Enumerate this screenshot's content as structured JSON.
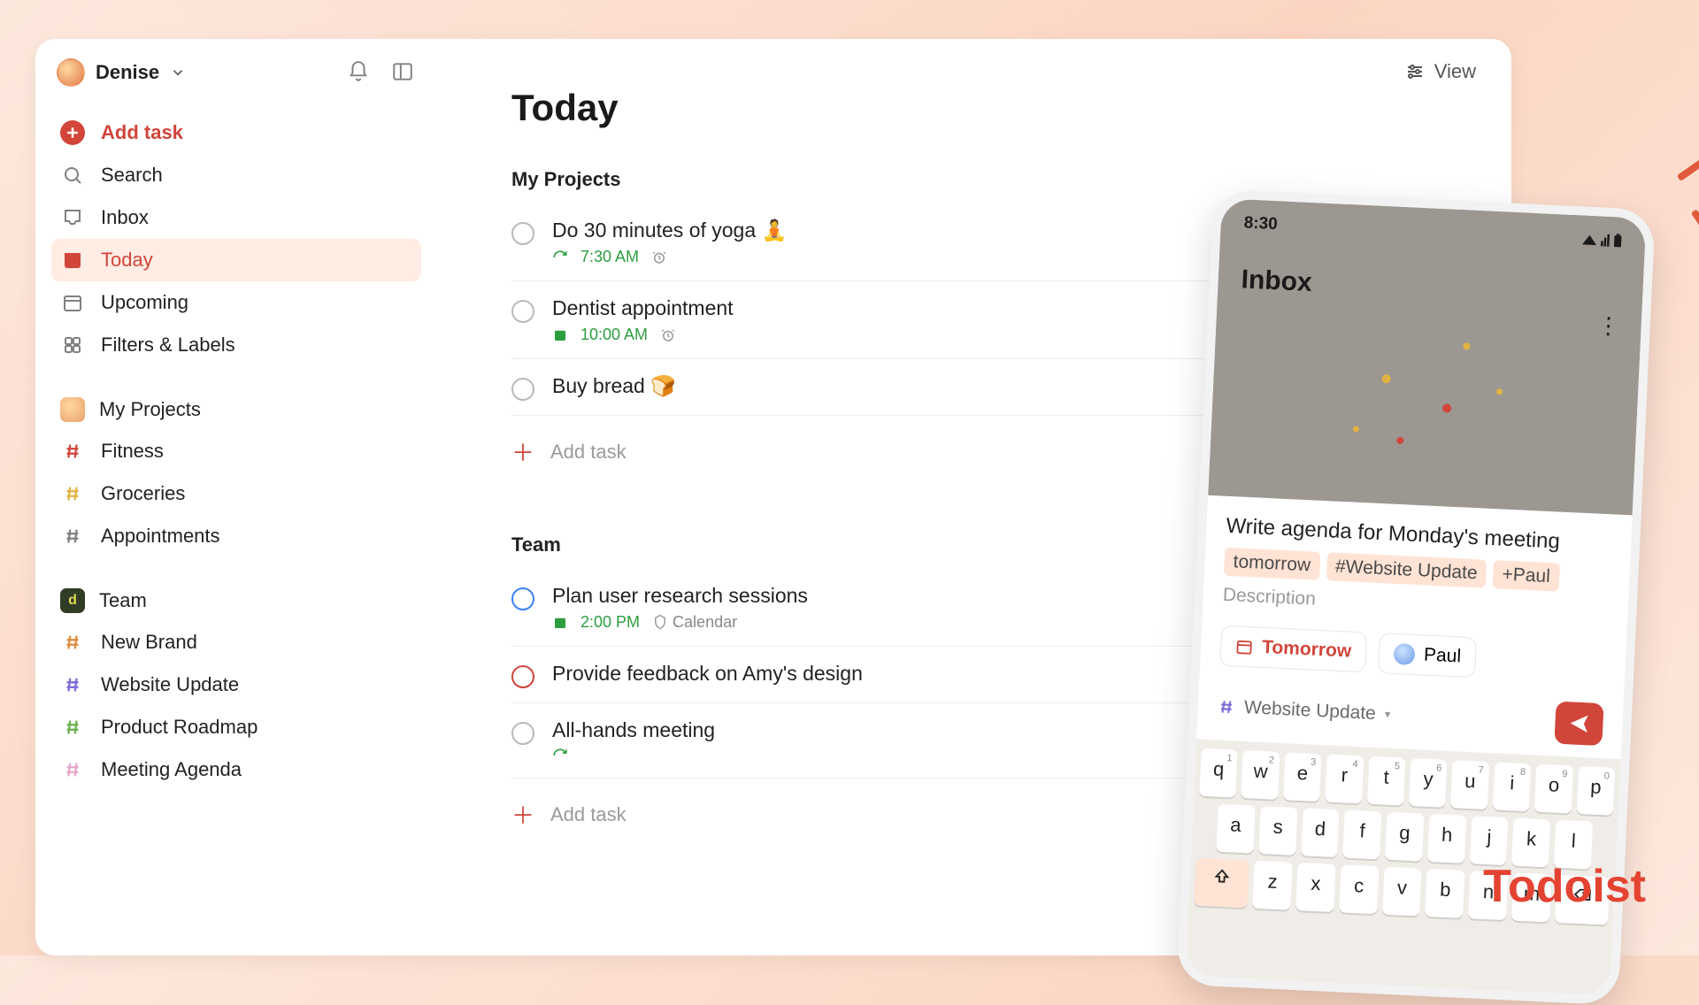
{
  "brand": "Todoist",
  "user": {
    "name": "Denise"
  },
  "toolbar": {
    "view_label": "View"
  },
  "sidebar": {
    "add_task": "Add task",
    "nav": [
      {
        "id": "search",
        "label": "Search"
      },
      {
        "id": "inbox",
        "label": "Inbox"
      },
      {
        "id": "today",
        "label": "Today",
        "active": true
      },
      {
        "id": "upcoming",
        "label": "Upcoming"
      },
      {
        "id": "filters",
        "label": "Filters & Labels"
      }
    ],
    "my_projects": {
      "title": "My Projects",
      "items": [
        {
          "label": "Fitness",
          "color": "#d1453b"
        },
        {
          "label": "Groceries",
          "color": "#e3b341"
        },
        {
          "label": "Appointments",
          "color": "#808080"
        }
      ]
    },
    "team": {
      "title": "Team",
      "badge": "d",
      "items": [
        {
          "label": "New Brand",
          "color": "#e08a3b"
        },
        {
          "label": "Website Update",
          "color": "#7a6ad8"
        },
        {
          "label": "Product Roadmap",
          "color": "#6ab04c"
        },
        {
          "label": "Meeting Agenda",
          "color": "#e6a6c8"
        }
      ]
    }
  },
  "main": {
    "title": "Today",
    "sections": [
      {
        "title": "My Projects",
        "tasks": [
          {
            "title": "Do 30 minutes of yoga 🧘",
            "time": "7:30 AM",
            "recurring": true,
            "alarm": true
          },
          {
            "title": "Dentist appointment",
            "time": "10:00 AM",
            "calendar": true,
            "alarm": true
          },
          {
            "title": "Buy bread 🍞"
          }
        ],
        "add_label": "Add task"
      },
      {
        "title": "Team",
        "tasks": [
          {
            "title": "Plan user research sessions",
            "time": "2:00 PM",
            "calendar": true,
            "extra": "Calendar",
            "priority": "blue"
          },
          {
            "title": "Provide feedback on Amy's design",
            "priority": "red"
          },
          {
            "title": "All-hands meeting",
            "recurring": true
          }
        ],
        "add_label": "Add task"
      }
    ]
  },
  "phone": {
    "time": "8:30",
    "screen_title": "Inbox",
    "compose": {
      "text": "Write agenda for Monday's meeting",
      "chips": [
        "tomorrow",
        "#Website Update",
        "+Paul"
      ],
      "description_placeholder": "Description",
      "date_pill": "Tomorrow",
      "assignee": "Paul",
      "project": "Website Update"
    },
    "keyboard": {
      "row1": [
        "q",
        "w",
        "e",
        "r",
        "t",
        "y",
        "u",
        "i",
        "o",
        "p"
      ],
      "row1_sup": [
        "1",
        "2",
        "3",
        "4",
        "5",
        "6",
        "7",
        "8",
        "9",
        "0"
      ],
      "row2": [
        "a",
        "s",
        "d",
        "f",
        "g",
        "h",
        "j",
        "k",
        "l"
      ],
      "row3": [
        "z",
        "x",
        "c",
        "v",
        "b",
        "n",
        "m"
      ]
    }
  }
}
